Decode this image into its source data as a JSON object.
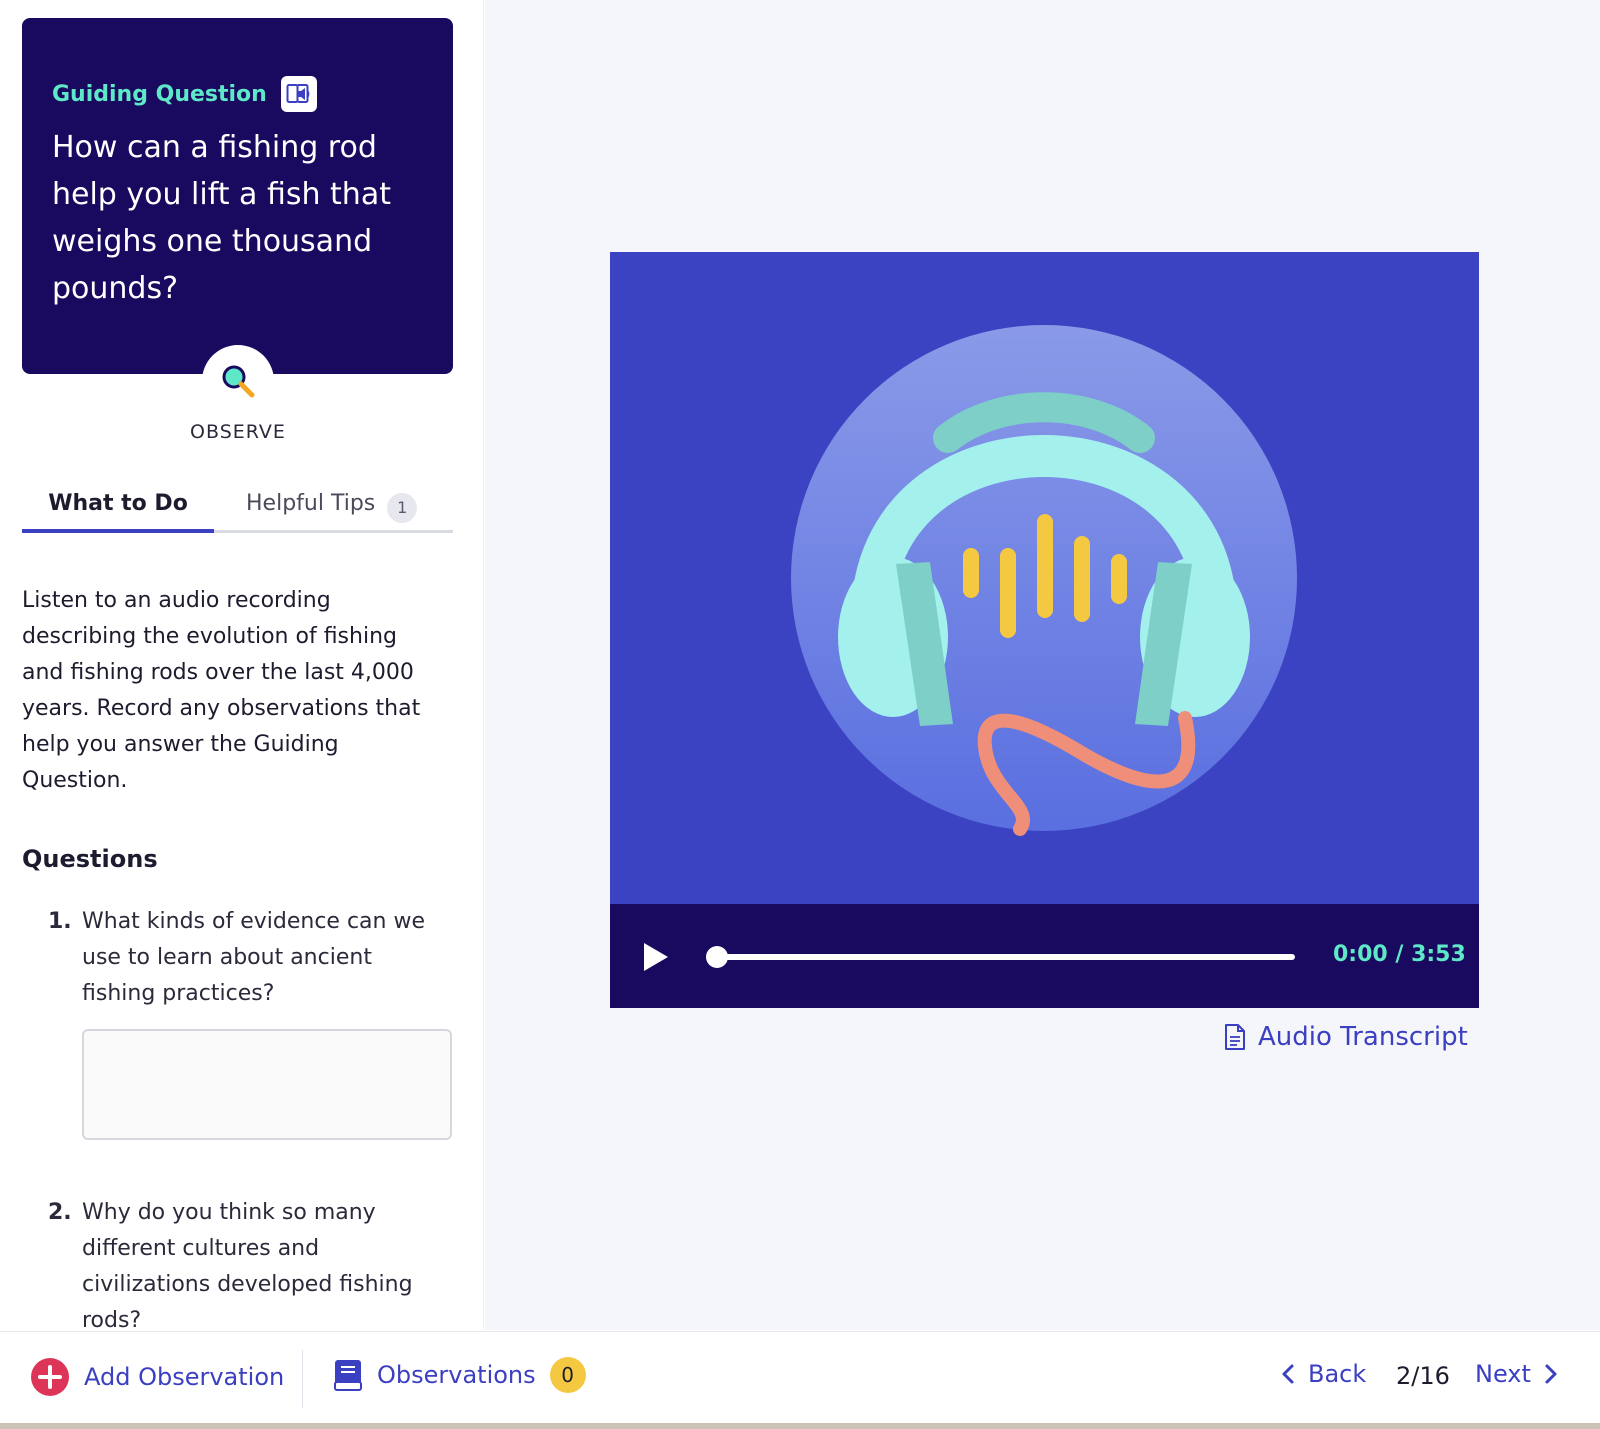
{
  "guiding_question": {
    "label": "Guiding Question",
    "question": "How can a fishing rod help you lift a fish that weighs one thousand pounds?"
  },
  "step": {
    "label": "OBSERVE"
  },
  "tabs": [
    {
      "label": "What to Do",
      "active": true
    },
    {
      "label": "Helpful Tips",
      "count": "1",
      "active": false
    }
  ],
  "instructions": "Listen to an audio recording describing the evolution of fishing and fishing rods over the last 4,000 years. Record any observations that help you answer the Guiding Question.",
  "questions": {
    "title": "Questions",
    "items": [
      {
        "number": "1.",
        "text": "What kinds of evidence can we use to learn about ancient fishing practices?",
        "answer": ""
      },
      {
        "number": "2.",
        "text": "Why do you think so many different cultures and civilizations developed fishing rods?"
      }
    ]
  },
  "player": {
    "time": "0:00 / 3:53",
    "progress_fraction": 0,
    "transcript_label": "Audio Transcript"
  },
  "footer": {
    "add_observation": "Add Observation",
    "observations": "Observations",
    "observations_count": "0",
    "back": "Back",
    "page": "2/16",
    "next": "Next"
  },
  "colors": {
    "card_bg": "#19095f",
    "accent_teal": "#5ee8c8",
    "link_blue": "#3b3fc1",
    "player_bg": "#3c43c2",
    "badge_yellow": "#f5c842",
    "add_red": "#dd3558"
  },
  "icons": {
    "guiding_audio": "read-aloud-icon",
    "observe": "magnifier-icon",
    "player_art": "headphones-icon",
    "play": "play-icon",
    "transcript": "document-icon",
    "add": "plus-circle-icon",
    "observations": "notebook-icon",
    "back": "chevron-left-icon",
    "next": "chevron-right-icon"
  }
}
